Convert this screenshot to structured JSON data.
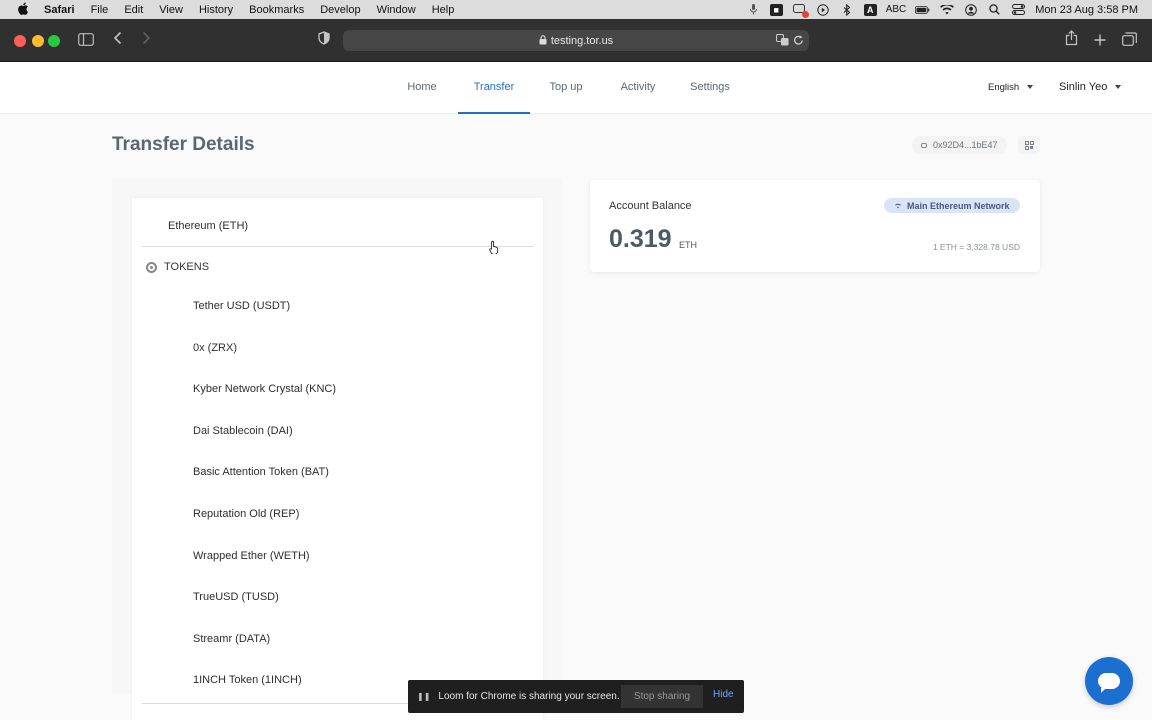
{
  "menubar": {
    "app": "Safari",
    "items": [
      "File",
      "Edit",
      "View",
      "History",
      "Bookmarks",
      "Develop",
      "Window",
      "Help"
    ],
    "input_source": "ABC",
    "datetime": "Mon 23 Aug  3:58 PM",
    "tray_icons": [
      "microphone-icon",
      "zoom-icon",
      "notification-icon",
      "play-icon",
      "bluetooth-icon",
      "input-source-icon",
      "battery-icon",
      "wifi-icon",
      "user-icon",
      "spotlight-icon",
      "control-center-icon"
    ]
  },
  "browser": {
    "url": "testing.tor.us"
  },
  "nav": {
    "tabs": [
      "Home",
      "Transfer",
      "Top up",
      "Activity",
      "Settings"
    ],
    "active_tab": "Transfer",
    "language": "English",
    "user": "Sinlin Yeo"
  },
  "page": {
    "title": "Transfer Details",
    "address": "0x92D4...1bE47"
  },
  "token_list": {
    "selected": "Ethereum (ETH)",
    "section_label": "TOKENS",
    "tokens": [
      "Tether USD (USDT)",
      "0x (ZRX)",
      "Kyber Network Crystal (KNC)",
      "Dai Stablecoin (DAI)",
      "Basic Attention Token (BAT)",
      "Reputation Old (REP)",
      "Wrapped Ether (WETH)",
      "TrueUSD (TUSD)",
      "Streamr (DATA)",
      "1INCH Token (1INCH)"
    ]
  },
  "balance": {
    "label": "Account Balance",
    "network": "Main Ethereum Network",
    "value": "0.319",
    "unit": "ETH",
    "rate": "1 ETH = 3,328.78 USD"
  },
  "loom": {
    "message": "Loom for Chrome is sharing your screen.",
    "stop_label": "Stop sharing",
    "hide_label": "Hide"
  },
  "colors": {
    "accent": "#1f6fd1",
    "network_chip": "#d9e4f7",
    "title": "#5c666f"
  }
}
